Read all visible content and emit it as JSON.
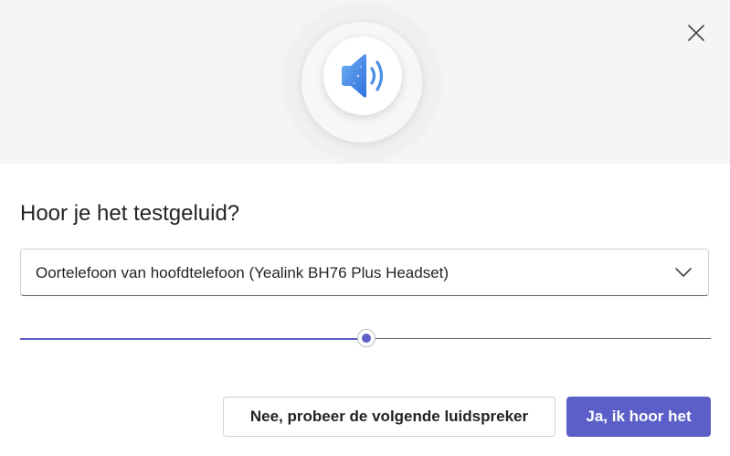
{
  "dialog": {
    "title": "Hoor je het testgeluid?",
    "close_icon": "close-icon",
    "hero_icon": "speaker-volume-icon"
  },
  "speaker_select": {
    "value": "Oortelefoon van hoofdtelefoon (Yealink BH76 Plus Headset)",
    "icon": "chevron-down-icon"
  },
  "volume": {
    "level": 0.5
  },
  "buttons": {
    "secondary_label": "Nee, probeer de volgende luidspreker",
    "primary_label": "Ja, ik hoor het"
  },
  "colors": {
    "accent": "#5b5fc7",
    "hero_background": "#f5f5f5",
    "icon_blue": "#4a90e8"
  }
}
